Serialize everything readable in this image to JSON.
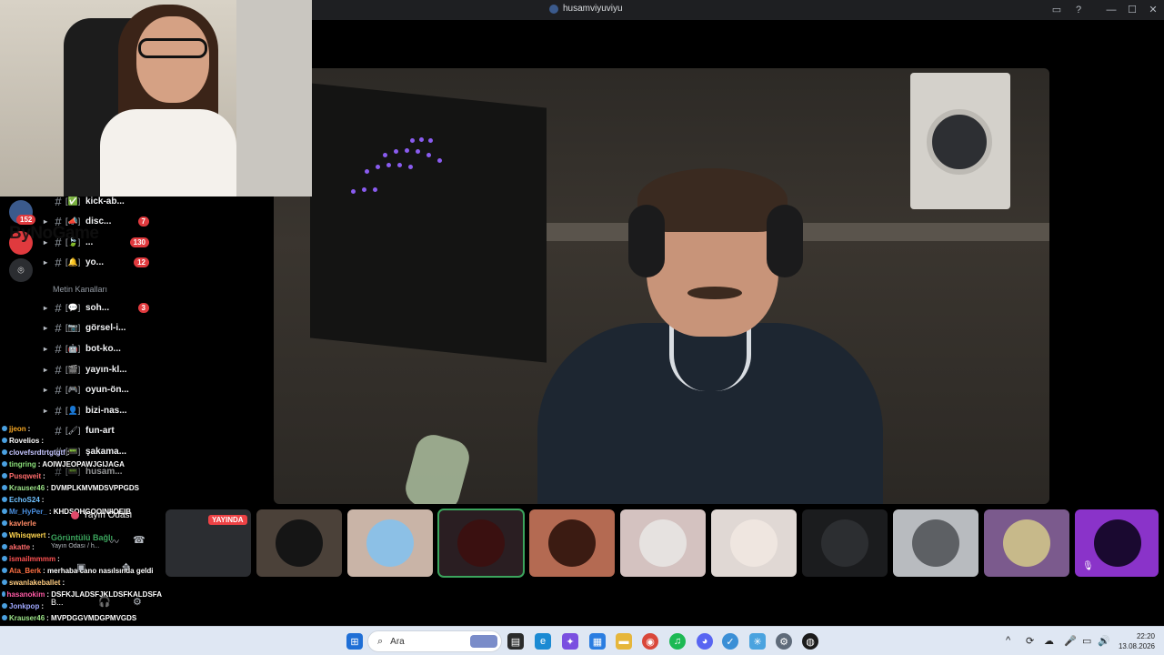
{
  "window": {
    "title": "husamviyuviyu",
    "controls": [
      "minimize",
      "maximize",
      "close"
    ]
  },
  "brand_overlay": "ByNoGame",
  "guilds": [
    {
      "badge": "152"
    },
    {
      "badge": ""
    },
    {
      "badge": ""
    }
  ],
  "channels": {
    "items": [
      {
        "emoji": "[✅]",
        "name": "kick-ab...",
        "badge": ""
      },
      {
        "emoji": "[📣]",
        "name": "disc...",
        "badge": "7"
      },
      {
        "emoji": "[🍃]",
        "name": "...",
        "badge": "130"
      },
      {
        "emoji": "[🔔]",
        "name": "yo...",
        "badge": "12"
      }
    ],
    "category": "Metin Kanalları",
    "text_items": [
      {
        "emoji": "[💬]",
        "name": "soh...",
        "badge": "3"
      },
      {
        "emoji": "[📷]",
        "name": "görsel-i...",
        "badge": ""
      },
      {
        "emoji": "[🤖]",
        "name": "bot-ko...",
        "badge": ""
      },
      {
        "emoji": "[🎬]",
        "name": "yayın-kl...",
        "badge": ""
      },
      {
        "emoji": "[🎮]",
        "name": "oyun-ön...",
        "badge": ""
      },
      {
        "emoji": "[👤]",
        "name": "bizi-nas...",
        "badge": ""
      },
      {
        "emoji": "[🖌]",
        "name": "fun-art",
        "badge": ""
      },
      {
        "emoji": "[📟]",
        "name": "şakama...",
        "badge": ""
      },
      {
        "emoji": "[📟]",
        "name": "husam...",
        "badge": ""
      }
    ]
  },
  "chat": [
    {
      "user": "jjeon",
      "text": ":",
      "color": "#f5a623"
    },
    {
      "user": "Rovelios",
      "text": ":",
      "color": "#ffffff"
    },
    {
      "user": "clovefsrdtrtgtgtf",
      "text": ":",
      "color": "#c5c5ff"
    },
    {
      "user": "tingring",
      "text": ": AOIWJEOPAWJGIJAGA",
      "color": "#8be07a"
    },
    {
      "user": "Pusqweit",
      "text": ":",
      "color": "#ff6b6b"
    },
    {
      "user": "Krauser46",
      "text": ": DVMPLKMVMDSVPPGDS",
      "color": "#9ee68a"
    },
    {
      "user": "EchoS24",
      "text": ":",
      "color": "#6ec1ff"
    },
    {
      "user": "Mr_HyPer_",
      "text": ": KHDSOHGOOINIIOEIB",
      "color": "#4a90e2"
    },
    {
      "user": "kavlerle",
      "text": "",
      "color": "#ff8a65"
    },
    {
      "user": "Whisqwert",
      "text": ":",
      "color": "#ffd54f"
    },
    {
      "user": "akatte",
      "text": ":",
      "color": "#ff6b6b"
    },
    {
      "user": "ismailmmmm",
      "text": ":",
      "color": "#ff5252"
    },
    {
      "user": "Ata_Berk",
      "text": ": merhaba cano nasılsında geldi",
      "color": "#ff7043"
    },
    {
      "user": "swanlakeballet",
      "text": ":",
      "color": "#ffcc80"
    },
    {
      "user": "hasanokim",
      "text": ": DSFKJLADSFJKLDSFKALDSFA",
      "color": "#ff5aa5"
    },
    {
      "user": "Jonkpop",
      "text": ":",
      "color": "#9fa8ff"
    },
    {
      "user": "Krauser46",
      "text": ": MVPDGGVMDGPMVGDS",
      "color": "#9ee68a"
    }
  ],
  "voice": {
    "room": "Yayın Odası",
    "status": "Görüntülü Bağlı",
    "sub": "Yayın Odası / h...",
    "user_short": "B..."
  },
  "stream": {
    "live_label": "YAYINDA"
  },
  "participants": [
    {
      "color": "#1e1f22"
    },
    {
      "color": "#4b4139"
    },
    {
      "color": "#c9b4a7"
    },
    {
      "color": "#2a1e22"
    },
    {
      "color": "#b46a52"
    },
    {
      "color": "#d4c2c0"
    },
    {
      "color": "#e0d8d4"
    },
    {
      "color": "#1b1c1e"
    },
    {
      "color": "#b8bbbf"
    },
    {
      "color": "#7b5a8d"
    },
    {
      "color": "#8a33c9"
    }
  ],
  "taskbar": {
    "search_placeholder": "Ara",
    "time": "22:20",
    "date": "13.08.2026",
    "caret": "^"
  }
}
